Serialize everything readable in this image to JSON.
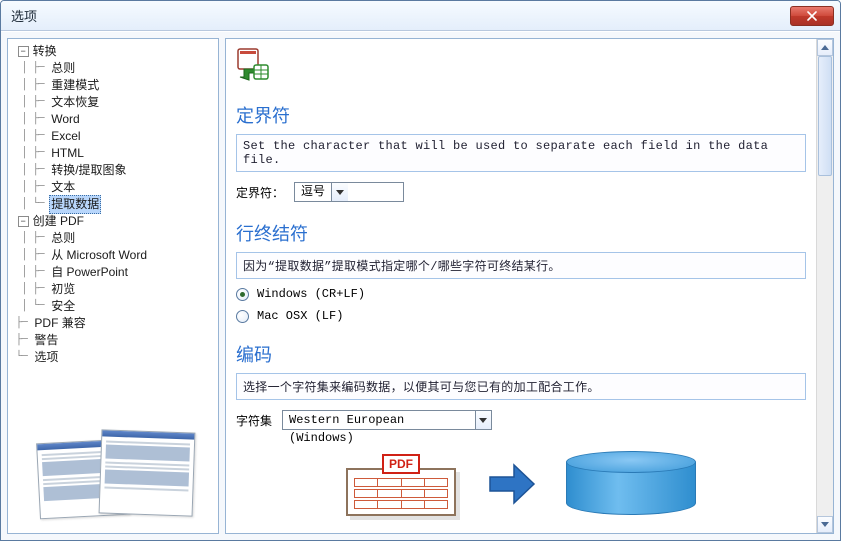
{
  "window": {
    "title": "选项"
  },
  "tree": {
    "convert": {
      "label": "转换",
      "children": {
        "general": "总则",
        "rebuild": "重建模式",
        "textrec": "文本恢复",
        "word": "Word",
        "excel": "Excel",
        "html": "HTML",
        "extractimg": "转换/提取图象",
        "text": "文本",
        "extractdata": "提取数据"
      }
    },
    "createpdf": {
      "label": "创建 PDF",
      "children": {
        "general": "总则",
        "fromword": "从 Microsoft Word",
        "fromppt": "自 PowerPoint",
        "preview": "初览",
        "security": "安全"
      }
    },
    "pdfcompat": "PDF 兼容",
    "warnings": "警告",
    "options": "选项"
  },
  "sections": {
    "delimiter": {
      "title": "定界符",
      "desc": "Set the character that will be used to separate each field in the data file.",
      "field_label": "定界符：",
      "value": "逗号"
    },
    "lineterm": {
      "title": "行终结符",
      "desc": "因为“提取数据”提取模式指定哪个/哪些字符可终结某行。",
      "opt_windows": "Windows (CR+LF)",
      "opt_mac": "Mac OSX (LF)",
      "selected": "windows"
    },
    "encoding": {
      "title": "编码",
      "desc": "选择一个字符集来编码数据，以便其可与您已有的加工配合工作。",
      "field_label": "字符集",
      "value": "Western European (Windows)"
    }
  },
  "diagram": {
    "pdf_label": "PDF"
  }
}
